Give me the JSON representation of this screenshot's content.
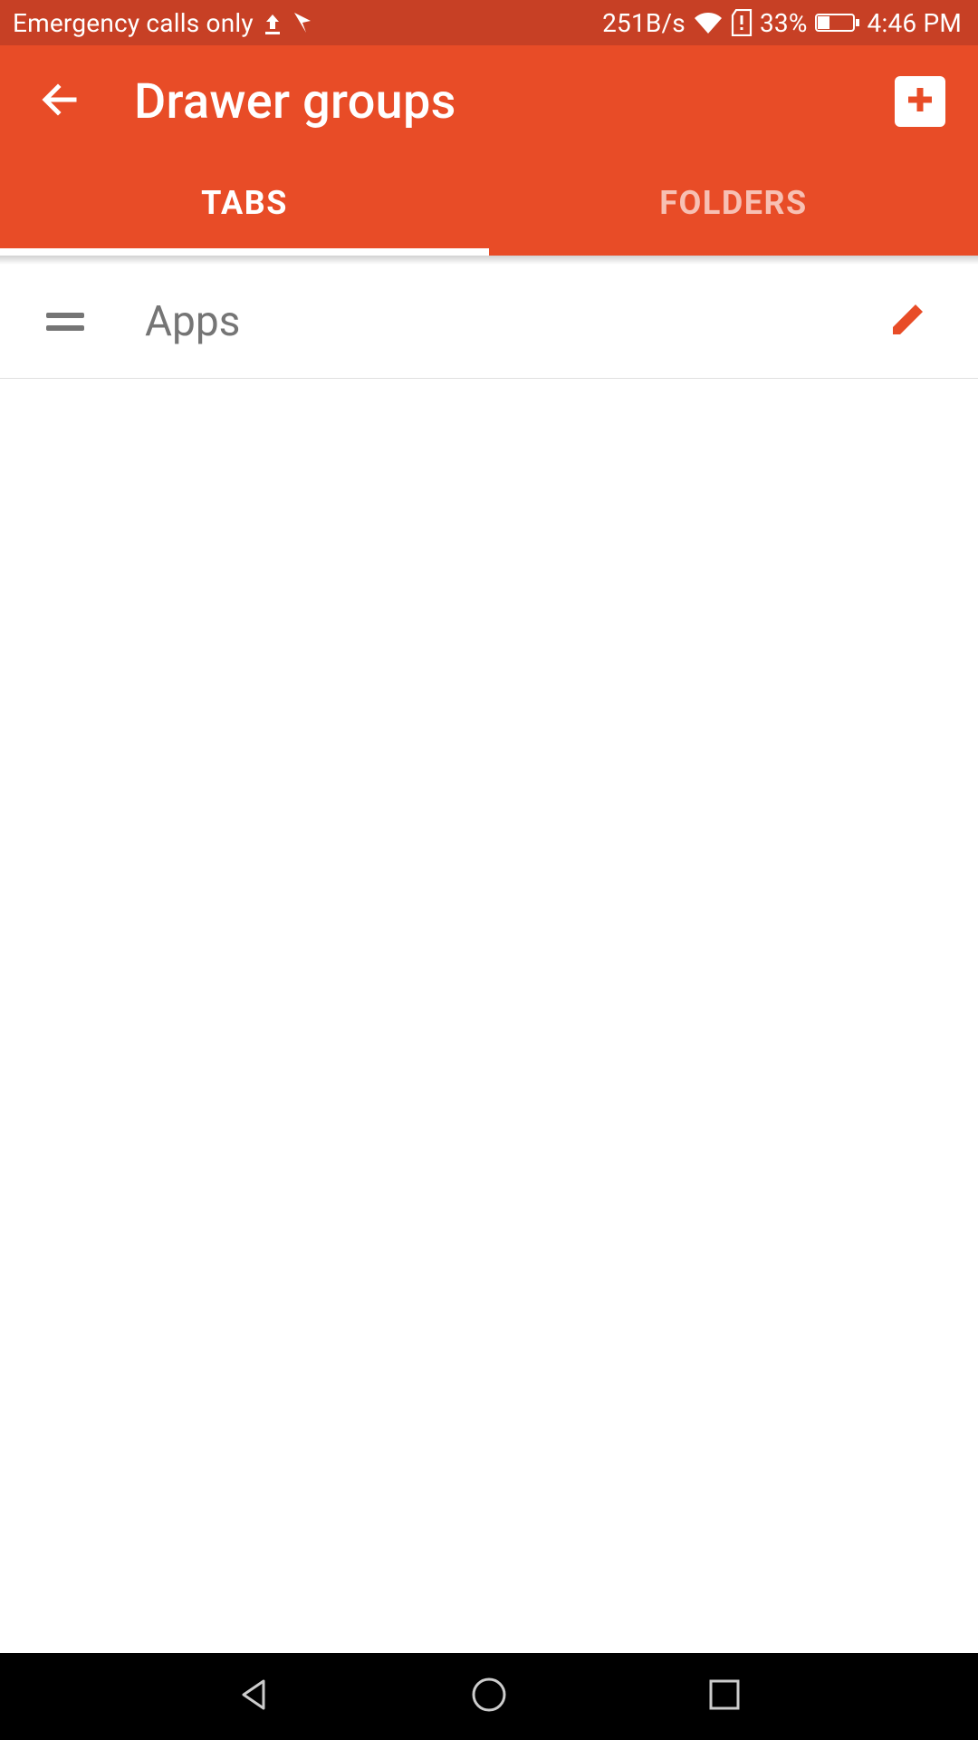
{
  "status_bar": {
    "carrier_text": "Emergency calls only",
    "data_rate": "251B/s",
    "battery_pct": "33%",
    "time": "4:46 PM"
  },
  "appbar": {
    "title": "Drawer groups"
  },
  "tabs": {
    "items": [
      "TABS",
      "FOLDERS"
    ],
    "active_index": 0
  },
  "list": {
    "rows": [
      {
        "label": "Apps"
      }
    ]
  },
  "colors": {
    "primary": "#e84c27",
    "primary_dark": "#c74025",
    "text_secondary": "#757575"
  }
}
